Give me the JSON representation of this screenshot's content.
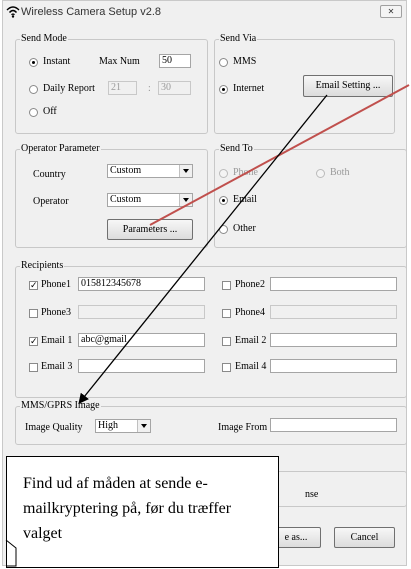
{
  "window": {
    "title": "Wireless Camera Setup  v2.8",
    "close_label": "✕"
  },
  "send_mode": {
    "legend": "Send Mode",
    "instant": "Instant",
    "max_num_label": "Max Num",
    "max_num_value": "50",
    "daily_report": "Daily Report",
    "time_hour": "21",
    "time_sep": ":",
    "time_min": "30",
    "off": "Off"
  },
  "send_via": {
    "legend": "Send Via",
    "mms": "MMS",
    "internet": "Internet",
    "email_setting": "Email Setting ..."
  },
  "operator": {
    "legend": "Operator Parameter",
    "country_label": "Country",
    "country_value": "Custom",
    "operator_label": "Operator",
    "operator_value": "Custom",
    "parameters_button": "Parameters ..."
  },
  "send_to": {
    "legend": "Send To",
    "phone": "Phone",
    "both": "Both",
    "email": "Email",
    "other": "Other"
  },
  "recipients": {
    "legend": "Recipients",
    "phone1": "Phone1",
    "phone1_value": "015812345678",
    "phone2": "Phone2",
    "phone3": "Phone3",
    "phone4": "Phone4",
    "email1": "Email 1",
    "email1_value": "abc@gmail",
    "email2": "Email 2",
    "email3": "Email 3",
    "email4": "Email 4"
  },
  "image": {
    "legend": "MMS/GPRS Image",
    "quality_label": "Image Quality",
    "quality_value": "High",
    "image_from_label": "Image From"
  },
  "bottom": {
    "license_partial": "nse",
    "save_as_partial": "e as...",
    "cancel": "Cancel"
  },
  "annotation": {
    "text": "Find ud af måden at sende e-mailkryptering på, før du træffer valget"
  },
  "colors": {
    "red_arrow": "#c0504d",
    "black_arrow": "#000000"
  }
}
